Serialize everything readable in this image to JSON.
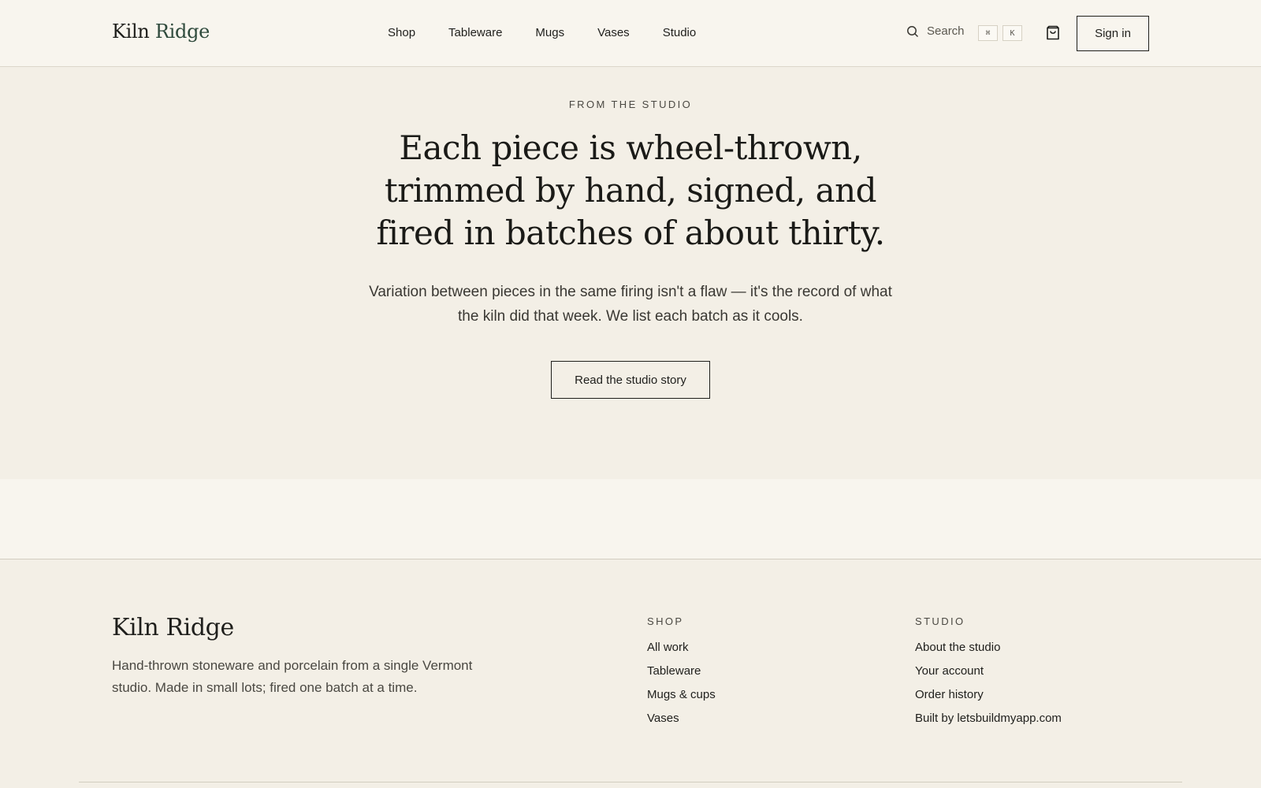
{
  "header": {
    "logo_primary": "Kiln",
    "logo_accent": "Ridge",
    "nav": [
      "Shop",
      "Tableware",
      "Mugs",
      "Vases",
      "Studio"
    ],
    "search_label": "Search",
    "shortcut_keys": [
      "⌘",
      "K"
    ],
    "signin_label": "Sign in",
    "icons": {
      "search": "search-icon",
      "cart": "shopping-bag-icon"
    }
  },
  "hero": {
    "eyebrow": "FROM THE STUDIO",
    "headline": "Each piece is wheel-thrown, trimmed by hand, signed, and fired in batches of about thirty.",
    "lede": "Variation between pieces in the same firing isn't a flaw — it's the record of what the kiln did that week. We list each batch as it cools.",
    "cta_label": "Read the studio story"
  },
  "footer": {
    "logo": "Kiln Ridge",
    "description": "Hand-thrown stoneware and porcelain from a single Vermont studio. Made in small lots; fired one batch at a time.",
    "shop": {
      "heading": "SHOP",
      "links": [
        "All work",
        "Tableware",
        "Mugs & cups",
        "Vases"
      ]
    },
    "studio": {
      "heading": "STUDIO",
      "links": [
        "About the studio",
        "Your account",
        "Order history",
        "Built by letsbuildmyapp.com"
      ]
    }
  },
  "colors": {
    "background": "#f3efe6",
    "header_bg": "#f8f5ee",
    "ink": "#1f1f1c",
    "logo_accent": "#2f4a3c"
  }
}
